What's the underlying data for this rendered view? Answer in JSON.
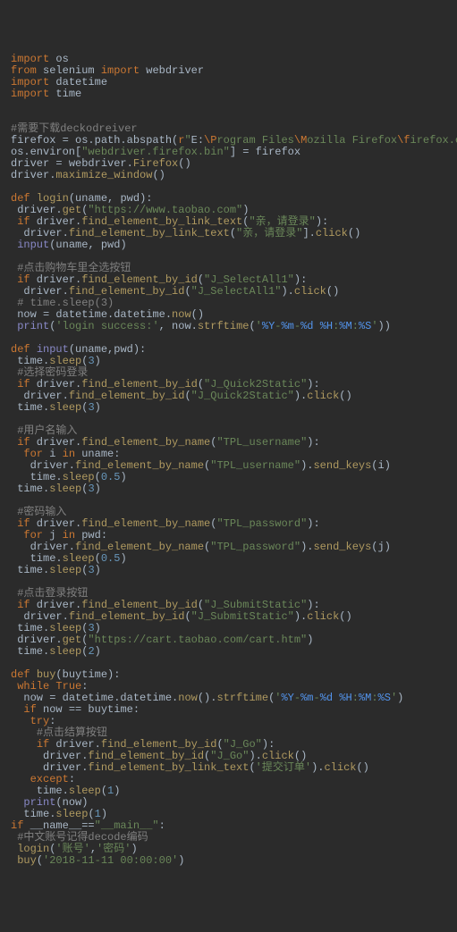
{
  "lines": [
    [
      [
        "kw",
        "import"
      ],
      [
        "id",
        " os"
      ]
    ],
    [
      [
        "kw",
        "from"
      ],
      [
        "id",
        " selenium "
      ],
      [
        "kw",
        "import"
      ],
      [
        "id",
        " webdriver"
      ]
    ],
    [
      [
        "kw",
        "import"
      ],
      [
        "id",
        " datetime"
      ]
    ],
    [
      [
        "kw",
        "import"
      ],
      [
        "id",
        " time"
      ]
    ],
    [],
    [],
    [
      [
        "cm",
        "#需要下载deckodreiver"
      ]
    ],
    [
      [
        "id",
        "firefox "
      ],
      [
        "par",
        "="
      ],
      [
        "id",
        " os.path.abspath("
      ],
      [
        "kw",
        "r"
      ],
      [
        "str",
        "\""
      ],
      [
        "id",
        "E:"
      ],
      [
        "esc",
        "\\P"
      ],
      [
        "str",
        "rogram Files"
      ],
      [
        "esc",
        "\\M"
      ],
      [
        "str",
        "ozilla Firefox"
      ],
      [
        "esc",
        "\\f"
      ],
      [
        "str",
        "irefox.exe"
      ],
      [
        "str",
        "\""
      ],
      [
        "id",
        ")"
      ]
    ],
    [
      [
        "id",
        "os.environ["
      ],
      [
        "str",
        "\"webdriver.firefox.bin\""
      ],
      [
        "id",
        "] "
      ],
      [
        "par",
        "="
      ],
      [
        "id",
        " firefox"
      ]
    ],
    [
      [
        "id",
        "driver "
      ],
      [
        "par",
        "="
      ],
      [
        "id",
        " webdriver."
      ],
      [
        "fn",
        "Firefox"
      ],
      [
        "id",
        "()"
      ]
    ],
    [
      [
        "id",
        "driver."
      ],
      [
        "fn",
        "maximize_window"
      ],
      [
        "id",
        "()"
      ]
    ],
    [],
    [
      [
        "kw",
        "def "
      ],
      [
        "fn",
        "login"
      ],
      [
        "id",
        "("
      ],
      [
        "id",
        "uname"
      ],
      [
        "par",
        ", "
      ],
      [
        "id",
        "pwd"
      ],
      [
        "id",
        "):"
      ]
    ],
    [
      [
        "id",
        " driver."
      ],
      [
        "fn",
        "get"
      ],
      [
        "id",
        "("
      ],
      [
        "str",
        "\"https://www.taobao.com\""
      ],
      [
        "id",
        ")"
      ]
    ],
    [
      [
        "id",
        " "
      ],
      [
        "kw",
        "if"
      ],
      [
        "id",
        " driver."
      ],
      [
        "fn",
        "find_element_by_link_text"
      ],
      [
        "id",
        "("
      ],
      [
        "str",
        "\"亲，请登录\""
      ],
      [
        "id",
        "):"
      ]
    ],
    [
      [
        "id",
        "  driver."
      ],
      [
        "fn",
        "find_element_by_link_text"
      ],
      [
        "id",
        "("
      ],
      [
        "str",
        "\"亲，请登录\""
      ],
      [
        "id",
        "]."
      ],
      [
        "fn",
        "click"
      ],
      [
        "id",
        "()"
      ]
    ],
    [
      [
        "id",
        " "
      ],
      [
        "bi",
        "input"
      ],
      [
        "id",
        "(uname"
      ],
      [
        "par",
        ", "
      ],
      [
        "id",
        "pwd)"
      ]
    ],
    [],
    [
      [
        "id",
        " "
      ],
      [
        "cm",
        "#点击购物车里全选按钮"
      ]
    ],
    [
      [
        "id",
        " "
      ],
      [
        "kw",
        "if"
      ],
      [
        "id",
        " driver."
      ],
      [
        "fn",
        "find_element_by_id"
      ],
      [
        "id",
        "("
      ],
      [
        "str",
        "\"J_SelectAll1\""
      ],
      [
        "id",
        "):"
      ]
    ],
    [
      [
        "id",
        "  driver."
      ],
      [
        "fn",
        "find_element_by_id"
      ],
      [
        "id",
        "("
      ],
      [
        "str",
        "\"J_SelectAll1\""
      ],
      [
        "id",
        ")."
      ],
      [
        "fn",
        "click"
      ],
      [
        "id",
        "()"
      ]
    ],
    [
      [
        "id",
        " "
      ],
      [
        "cm",
        "# time.sleep(3)"
      ]
    ],
    [
      [
        "id",
        " now "
      ],
      [
        "par",
        "="
      ],
      [
        "id",
        " datetime.datetime."
      ],
      [
        "fn",
        "now"
      ],
      [
        "id",
        "()"
      ]
    ],
    [
      [
        "id",
        " "
      ],
      [
        "bi",
        "print"
      ],
      [
        "id",
        "("
      ],
      [
        "str",
        "'login success:'"
      ],
      [
        "par",
        ", "
      ],
      [
        "id",
        "now."
      ],
      [
        "fn",
        "strftime"
      ],
      [
        "id",
        "("
      ],
      [
        "str",
        "'"
      ],
      [
        "fmt",
        "%Y"
      ],
      [
        "str",
        "-"
      ],
      [
        "fmt",
        "%m"
      ],
      [
        "str",
        "-"
      ],
      [
        "fmt",
        "%d"
      ],
      [
        "str",
        " "
      ],
      [
        "fmt",
        "%H"
      ],
      [
        "str",
        ":"
      ],
      [
        "fmt",
        "%M"
      ],
      [
        "str",
        ":"
      ],
      [
        "fmt",
        "%S"
      ],
      [
        "str",
        "'"
      ],
      [
        "id",
        "))"
      ]
    ],
    [],
    [
      [
        "kw",
        "def "
      ],
      [
        "bi",
        "input"
      ],
      [
        "id",
        "("
      ],
      [
        "id",
        "uname"
      ],
      [
        "par",
        ","
      ],
      [
        "id",
        "pwd"
      ],
      [
        "id",
        "):"
      ]
    ],
    [
      [
        "id",
        " time."
      ],
      [
        "fn",
        "sleep"
      ],
      [
        "id",
        "("
      ],
      [
        "num",
        "3"
      ],
      [
        "id",
        ")"
      ]
    ],
    [
      [
        "id",
        " "
      ],
      [
        "cm",
        "#选择密码登录"
      ]
    ],
    [
      [
        "id",
        " "
      ],
      [
        "kw",
        "if"
      ],
      [
        "id",
        " driver."
      ],
      [
        "fn",
        "find_element_by_id"
      ],
      [
        "id",
        "("
      ],
      [
        "str",
        "\"J_Quick2Static\""
      ],
      [
        "id",
        "):"
      ]
    ],
    [
      [
        "id",
        "  driver."
      ],
      [
        "fn",
        "find_element_by_id"
      ],
      [
        "id",
        "("
      ],
      [
        "str",
        "\"J_Quick2Static\""
      ],
      [
        "id",
        ")."
      ],
      [
        "fn",
        "click"
      ],
      [
        "id",
        "()"
      ]
    ],
    [
      [
        "id",
        " time."
      ],
      [
        "fn",
        "sleep"
      ],
      [
        "id",
        "("
      ],
      [
        "num",
        "3"
      ],
      [
        "id",
        ")"
      ]
    ],
    [],
    [
      [
        "id",
        " "
      ],
      [
        "cm",
        "#用户名输入"
      ]
    ],
    [
      [
        "id",
        " "
      ],
      [
        "kw",
        "if"
      ],
      [
        "id",
        " driver."
      ],
      [
        "fn",
        "find_element_by_name"
      ],
      [
        "id",
        "("
      ],
      [
        "str",
        "\"TPL_username\""
      ],
      [
        "id",
        "):"
      ]
    ],
    [
      [
        "id",
        "  "
      ],
      [
        "kw",
        "for"
      ],
      [
        "id",
        " i "
      ],
      [
        "kw",
        "in"
      ],
      [
        "id",
        " uname:"
      ]
    ],
    [
      [
        "id",
        "   driver."
      ],
      [
        "fn",
        "find_element_by_name"
      ],
      [
        "id",
        "("
      ],
      [
        "str",
        "\"TPL_username\""
      ],
      [
        "id",
        ")."
      ],
      [
        "fn",
        "send_keys"
      ],
      [
        "id",
        "(i)"
      ]
    ],
    [
      [
        "id",
        "   time."
      ],
      [
        "fn",
        "sleep"
      ],
      [
        "id",
        "("
      ],
      [
        "num",
        "0.5"
      ],
      [
        "id",
        ")"
      ]
    ],
    [
      [
        "id",
        " time."
      ],
      [
        "fn",
        "sleep"
      ],
      [
        "id",
        "("
      ],
      [
        "num",
        "3"
      ],
      [
        "id",
        ")"
      ]
    ],
    [],
    [
      [
        "id",
        " "
      ],
      [
        "cm",
        "#密码输入"
      ]
    ],
    [
      [
        "id",
        " "
      ],
      [
        "kw",
        "if"
      ],
      [
        "id",
        " driver."
      ],
      [
        "fn",
        "find_element_by_name"
      ],
      [
        "id",
        "("
      ],
      [
        "str",
        "\"TPL_password\""
      ],
      [
        "id",
        "):"
      ]
    ],
    [
      [
        "id",
        "  "
      ],
      [
        "kw",
        "for"
      ],
      [
        "id",
        " j "
      ],
      [
        "kw",
        "in"
      ],
      [
        "id",
        " pwd:"
      ]
    ],
    [
      [
        "id",
        "   driver."
      ],
      [
        "fn",
        "find_element_by_name"
      ],
      [
        "id",
        "("
      ],
      [
        "str",
        "\"TPL_password\""
      ],
      [
        "id",
        ")."
      ],
      [
        "fn",
        "send_keys"
      ],
      [
        "id",
        "(j)"
      ]
    ],
    [
      [
        "id",
        "   time."
      ],
      [
        "fn",
        "sleep"
      ],
      [
        "id",
        "("
      ],
      [
        "num",
        "0.5"
      ],
      [
        "id",
        ")"
      ]
    ],
    [
      [
        "id",
        " time."
      ],
      [
        "fn",
        "sleep"
      ],
      [
        "id",
        "("
      ],
      [
        "num",
        "3"
      ],
      [
        "id",
        ")"
      ]
    ],
    [],
    [
      [
        "id",
        " "
      ],
      [
        "cm",
        "#点击登录按钮"
      ]
    ],
    [
      [
        "id",
        " "
      ],
      [
        "kw",
        "if"
      ],
      [
        "id",
        " driver."
      ],
      [
        "fn",
        "find_element_by_id"
      ],
      [
        "id",
        "("
      ],
      [
        "str",
        "\"J_SubmitStatic\""
      ],
      [
        "id",
        "):"
      ]
    ],
    [
      [
        "id",
        "  driver."
      ],
      [
        "fn",
        "find_element_by_id"
      ],
      [
        "id",
        "("
      ],
      [
        "str",
        "\"J_SubmitStatic\""
      ],
      [
        "id",
        ")."
      ],
      [
        "fn",
        "click"
      ],
      [
        "id",
        "()"
      ]
    ],
    [
      [
        "id",
        " time."
      ],
      [
        "fn",
        "sleep"
      ],
      [
        "id",
        "("
      ],
      [
        "num",
        "3"
      ],
      [
        "id",
        ")"
      ]
    ],
    [
      [
        "id",
        " driver."
      ],
      [
        "fn",
        "get"
      ],
      [
        "id",
        "("
      ],
      [
        "str",
        "\"https://cart.taobao.com/cart.htm\""
      ],
      [
        "id",
        ")"
      ]
    ],
    [
      [
        "id",
        " time."
      ],
      [
        "fn",
        "sleep"
      ],
      [
        "id",
        "("
      ],
      [
        "num",
        "2"
      ],
      [
        "id",
        ")"
      ]
    ],
    [],
    [
      [
        "kw",
        "def "
      ],
      [
        "fn",
        "buy"
      ],
      [
        "id",
        "("
      ],
      [
        "id",
        "buytime"
      ],
      [
        "id",
        "):"
      ]
    ],
    [
      [
        "id",
        " "
      ],
      [
        "kw",
        "while "
      ],
      [
        "kw",
        "True"
      ],
      [
        "id",
        ":"
      ]
    ],
    [
      [
        "id",
        "  now "
      ],
      [
        "par",
        "="
      ],
      [
        "id",
        " datetime.datetime."
      ],
      [
        "fn",
        "now"
      ],
      [
        "id",
        "()."
      ],
      [
        "fn",
        "strftime"
      ],
      [
        "id",
        "("
      ],
      [
        "str",
        "'"
      ],
      [
        "fmt",
        "%Y"
      ],
      [
        "str",
        "-"
      ],
      [
        "fmt",
        "%m"
      ],
      [
        "str",
        "-"
      ],
      [
        "fmt",
        "%d"
      ],
      [
        "str",
        " "
      ],
      [
        "fmt",
        "%H"
      ],
      [
        "str",
        ":"
      ],
      [
        "fmt",
        "%M"
      ],
      [
        "str",
        ":"
      ],
      [
        "fmt",
        "%S"
      ],
      [
        "str",
        "'"
      ],
      [
        "id",
        ")"
      ]
    ],
    [
      [
        "id",
        "  "
      ],
      [
        "kw",
        "if"
      ],
      [
        "id",
        " now "
      ],
      [
        "par",
        "=="
      ],
      [
        "id",
        " buytime:"
      ]
    ],
    [
      [
        "id",
        "   "
      ],
      [
        "kw",
        "try"
      ],
      [
        "id",
        ":"
      ]
    ],
    [
      [
        "id",
        "    "
      ],
      [
        "cm",
        "#点击结算按钮"
      ]
    ],
    [
      [
        "id",
        "    "
      ],
      [
        "kw",
        "if"
      ],
      [
        "id",
        " driver."
      ],
      [
        "fn",
        "find_element_by_id"
      ],
      [
        "id",
        "("
      ],
      [
        "str",
        "\"J_Go\""
      ],
      [
        "id",
        "):"
      ]
    ],
    [
      [
        "id",
        "     driver."
      ],
      [
        "fn",
        "find_element_by_id"
      ],
      [
        "id",
        "("
      ],
      [
        "str",
        "\"J_Go\""
      ],
      [
        "id",
        ")."
      ],
      [
        "fn",
        "click"
      ],
      [
        "id",
        "()"
      ]
    ],
    [
      [
        "id",
        "     driver."
      ],
      [
        "fn",
        "find_element_by_link_text"
      ],
      [
        "id",
        "("
      ],
      [
        "str",
        "'提交订单'"
      ],
      [
        "id",
        ")."
      ],
      [
        "fn",
        "click"
      ],
      [
        "id",
        "()"
      ]
    ],
    [
      [
        "id",
        "   "
      ],
      [
        "kw",
        "except"
      ],
      [
        "id",
        ":"
      ]
    ],
    [
      [
        "id",
        "    time."
      ],
      [
        "fn",
        "sleep"
      ],
      [
        "id",
        "("
      ],
      [
        "num",
        "1"
      ],
      [
        "id",
        ")"
      ]
    ],
    [
      [
        "id",
        "  "
      ],
      [
        "bi",
        "print"
      ],
      [
        "id",
        "(now)"
      ]
    ],
    [
      [
        "id",
        "  time."
      ],
      [
        "fn",
        "sleep"
      ],
      [
        "id",
        "("
      ],
      [
        "num",
        "1"
      ],
      [
        "id",
        ")"
      ]
    ],
    [
      [
        "kw",
        "if"
      ],
      [
        "id",
        " __name__"
      ],
      [
        "par",
        "=="
      ],
      [
        "str",
        "\"__main__\""
      ],
      [
        "id",
        ":"
      ]
    ],
    [
      [
        "id",
        " "
      ],
      [
        "cm",
        "#中文账号记得decode编码"
      ]
    ],
    [
      [
        "id",
        " "
      ],
      [
        "fn",
        "login"
      ],
      [
        "id",
        "("
      ],
      [
        "str",
        "'账号'"
      ],
      [
        "par",
        ","
      ],
      [
        "str",
        "'密码'"
      ],
      [
        "id",
        ")"
      ]
    ],
    [
      [
        "id",
        " "
      ],
      [
        "fn",
        "buy"
      ],
      [
        "id",
        "("
      ],
      [
        "str",
        "'2018-11-11 00:00:00'"
      ],
      [
        "id",
        ")"
      ]
    ]
  ]
}
